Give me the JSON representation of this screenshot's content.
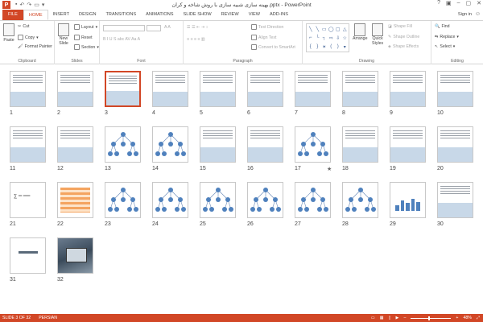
{
  "app": {
    "logo": "P",
    "title": "بهینه سازی شبیه سازی با روش شاخه و کران.pptx - PowerPoint",
    "sign_in": "Sign in"
  },
  "tabs": [
    "FILE",
    "HOME",
    "INSERT",
    "DESIGN",
    "TRANSITIONS",
    "ANIMATIONS",
    "SLIDE SHOW",
    "REVIEW",
    "VIEW",
    "ADD-INS"
  ],
  "active_tab": "HOME",
  "ribbon": {
    "clipboard": {
      "paste": "Paste",
      "cut": "Cut",
      "copy": "Copy",
      "format_painter": "Format Painter",
      "label": "Clipboard"
    },
    "slides": {
      "new_slide_1": "New",
      "new_slide_2": "Slide",
      "layout": "Layout",
      "reset": "Reset",
      "section": "Section",
      "label": "Slides"
    },
    "font": {
      "label": "Font"
    },
    "paragraph": {
      "text_direction": "Text Direction",
      "align_text": "Align Text",
      "convert_smartart": "Convert to SmartArt",
      "label": "Paragraph"
    },
    "drawing": {
      "arrange": "Arrange",
      "quick_styles_1": "Quick",
      "quick_styles_2": "Styles",
      "shape_fill": "Shape Fill",
      "shape_outline": "Shape Outline",
      "shape_effects": "Shape Effects",
      "label": "Drawing"
    },
    "editing": {
      "find": "Find",
      "replace": "Replace",
      "select": "Select",
      "label": "Editing"
    }
  },
  "slides": [
    {
      "n": "1",
      "kind": "text"
    },
    {
      "n": "2",
      "kind": "text"
    },
    {
      "n": "3",
      "kind": "text",
      "selected": true
    },
    {
      "n": "4",
      "kind": "text"
    },
    {
      "n": "5",
      "kind": "text"
    },
    {
      "n": "6",
      "kind": "text"
    },
    {
      "n": "7",
      "kind": "text"
    },
    {
      "n": "8",
      "kind": "text"
    },
    {
      "n": "9",
      "kind": "text"
    },
    {
      "n": "10",
      "kind": "text"
    },
    {
      "n": "11",
      "kind": "text"
    },
    {
      "n": "12",
      "kind": "text"
    },
    {
      "n": "13",
      "kind": "tree"
    },
    {
      "n": "14",
      "kind": "tree"
    },
    {
      "n": "15",
      "kind": "text"
    },
    {
      "n": "16",
      "kind": "text"
    },
    {
      "n": "17",
      "kind": "tree",
      "star": true
    },
    {
      "n": "18",
      "kind": "text"
    },
    {
      "n": "19",
      "kind": "text"
    },
    {
      "n": "20",
      "kind": "text"
    },
    {
      "n": "21",
      "kind": "formula"
    },
    {
      "n": "22",
      "kind": "table"
    },
    {
      "n": "23",
      "kind": "tree"
    },
    {
      "n": "24",
      "kind": "tree"
    },
    {
      "n": "25",
      "kind": "tree"
    },
    {
      "n": "26",
      "kind": "tree"
    },
    {
      "n": "27",
      "kind": "tree"
    },
    {
      "n": "28",
      "kind": "tree"
    },
    {
      "n": "29",
      "kind": "chart"
    },
    {
      "n": "30",
      "kind": "text"
    },
    {
      "n": "31",
      "kind": "title"
    },
    {
      "n": "32",
      "kind": "photo"
    }
  ],
  "status": {
    "slide_info": "SLIDE 3 OF 32",
    "language": "PERSIAN",
    "zoom": "48%"
  },
  "colors": {
    "accent": "#d24726"
  }
}
